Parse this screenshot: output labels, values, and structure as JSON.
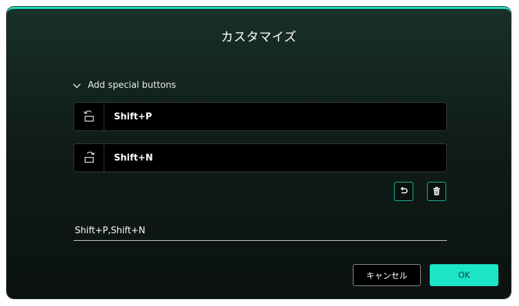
{
  "dialog": {
    "title": "カスタマイズ"
  },
  "section": {
    "label": "Add special buttons",
    "expanded": true,
    "icon": "chevron-down-icon"
  },
  "special_buttons": [
    {
      "icon": "rotate-left-icon",
      "shortcut": "Shift+P"
    },
    {
      "icon": "rotate-right-icon",
      "shortcut": "Shift+N"
    }
  ],
  "tools": {
    "undo_icon": "undo-icon",
    "delete_icon": "trash-icon"
  },
  "combined_shortcut": "Shift+P,Shift+N",
  "actions": {
    "cancel_label": "キャンセル",
    "ok_label": "OK"
  },
  "colors": {
    "accent": "#1de5c8",
    "accent_border": "#1fb59a",
    "background_top": "#18302a",
    "background_bottom": "#0b1210"
  }
}
